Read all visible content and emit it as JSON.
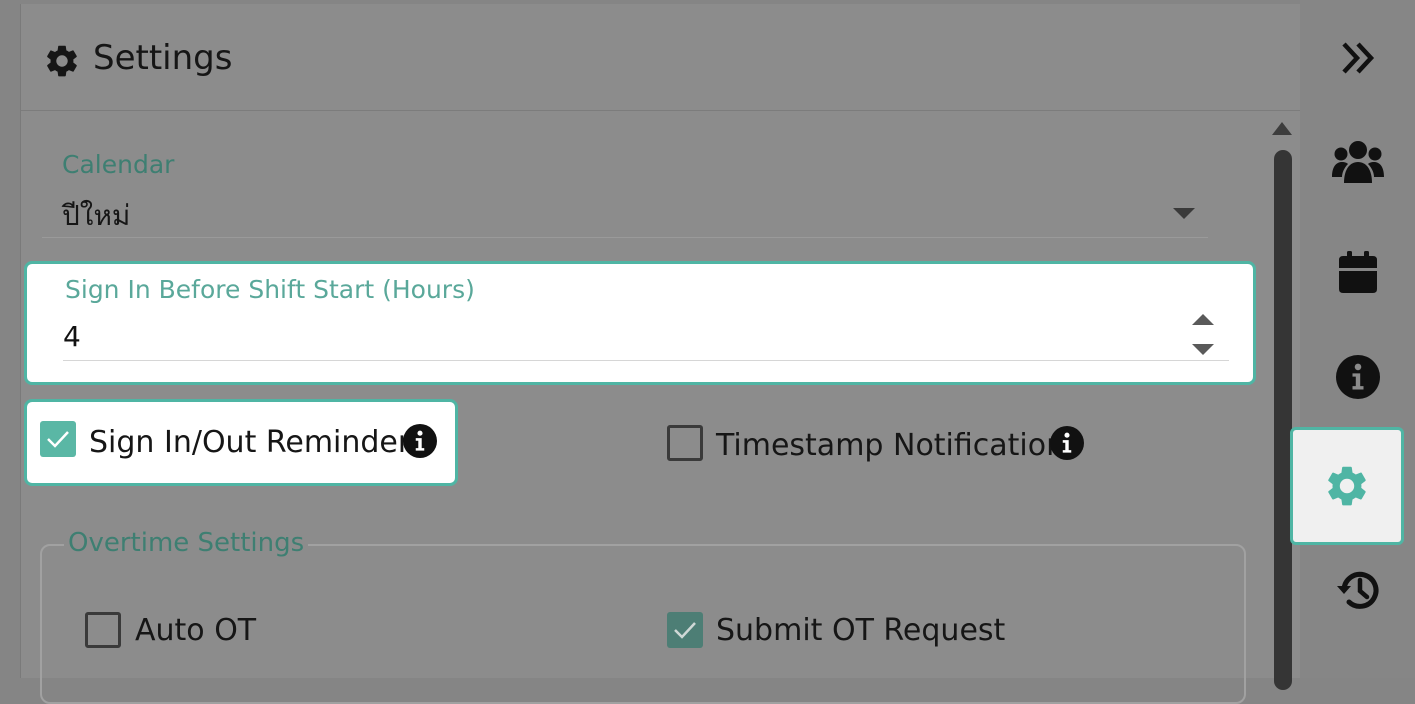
{
  "header": {
    "title": "Settings",
    "icon": "gear-icon"
  },
  "calendar": {
    "label": "Calendar",
    "value": "ปีใหม่"
  },
  "sign_in_before": {
    "label": "Sign In Before Shift Start (Hours)",
    "value": "4"
  },
  "reminder": {
    "label": "Sign In/Out Reminder",
    "checked": true
  },
  "timestamp": {
    "label": "Timestamp Notification",
    "checked": false
  },
  "overtime": {
    "legend": "Overtime Settings",
    "auto_ot": {
      "label": "Auto OT",
      "checked": false
    },
    "submit_ot": {
      "label": "Submit OT Request",
      "checked": true
    }
  },
  "rail": {
    "items": [
      {
        "icon": "double-chevron-right-icon"
      },
      {
        "icon": "users-icon"
      },
      {
        "icon": "calendar-icon"
      },
      {
        "icon": "info-icon"
      },
      {
        "icon": "gear-icon",
        "active": true
      },
      {
        "icon": "history-icon"
      }
    ]
  },
  "colors": {
    "accent": "#4fb5a4",
    "label": "#3e7f72",
    "overlay": "#8c8c8c"
  }
}
